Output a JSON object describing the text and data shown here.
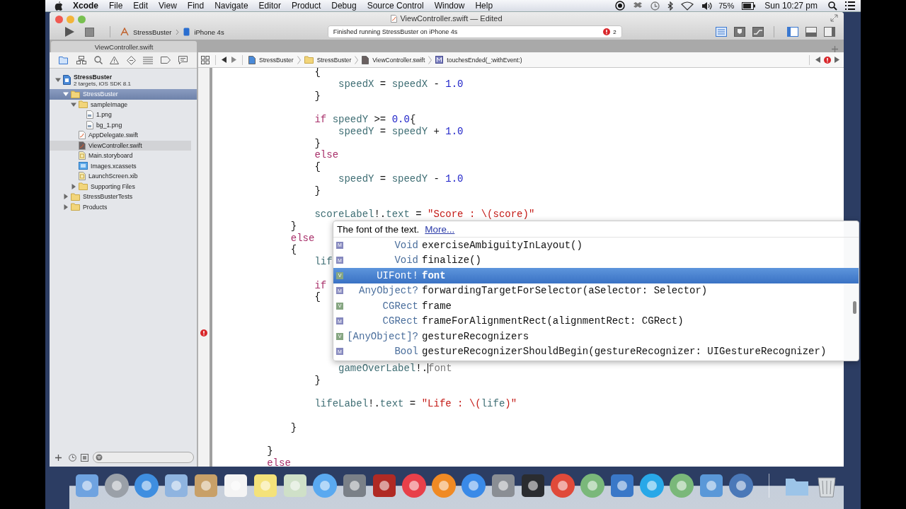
{
  "menu_bar": {
    "app": "Xcode",
    "menus": [
      "File",
      "Edit",
      "View",
      "Find",
      "Navigate",
      "Editor",
      "Product",
      "Debug",
      "Source Control",
      "Window",
      "Help"
    ],
    "battery": "75%",
    "clock": "Sun 10:27 pm"
  },
  "window": {
    "title": "ViewController.swift — Edited",
    "scheme": "StressBuster",
    "destination": "iPhone 4s",
    "status": "Finished running StressBuster on iPhone 4s",
    "error_count": "2"
  },
  "tabs": [
    {
      "label": "ViewController.swift",
      "selected": true
    }
  ],
  "navigator": {
    "tree": [
      {
        "name": "StressBuster",
        "subtitle": "2 targets, iOS SDK 8.1",
        "kind": "project",
        "expanded": true,
        "selected": false,
        "children": [
          {
            "name": "StressBuster",
            "kind": "folder",
            "expanded": true,
            "selected": true,
            "children": [
              {
                "name": "sampleImage",
                "kind": "folder",
                "expanded": true,
                "selected": false,
                "children": [
                  {
                    "name": "1.png",
                    "kind": "image",
                    "selected": false
                  },
                  {
                    "name": "bg_1.png",
                    "kind": "image",
                    "selected": false
                  }
                ]
              },
              {
                "name": "AppDelegate.swift",
                "kind": "swift",
                "selected": false
              },
              {
                "name": "ViewController.swift",
                "kind": "swift",
                "selected": false,
                "current": true
              },
              {
                "name": "Main.storyboard",
                "kind": "storyboard",
                "selected": false
              },
              {
                "name": "Images.xcassets",
                "kind": "assets",
                "selected": false
              },
              {
                "name": "LaunchScreen.xib",
                "kind": "xib",
                "selected": false
              },
              {
                "name": "Supporting Files",
                "kind": "folder",
                "expanded": false,
                "selected": false
              }
            ]
          },
          {
            "name": "StressBusterTests",
            "kind": "folder",
            "expanded": false,
            "selected": false
          },
          {
            "name": "Products",
            "kind": "folder",
            "expanded": false,
            "selected": false
          }
        ]
      }
    ]
  },
  "jump_bar": [
    {
      "label": "StressBuster",
      "kind": "project"
    },
    {
      "label": "StressBuster",
      "kind": "folder"
    },
    {
      "label": "ViewController.swift",
      "kind": "swift"
    },
    {
      "label": "touchesEnded(_:withEvent:)",
      "kind": "method"
    }
  ],
  "editor": {
    "lines": [
      {
        "kind": "code",
        "tokens": [
          {
            "text": "                {",
            "kind": "plain"
          }
        ]
      },
      {
        "kind": "code",
        "tokens": [
          {
            "text": "                    speedX",
            "kind": "identifier"
          },
          {
            "text": " = ",
            "kind": "plain"
          },
          {
            "text": "speedX",
            "kind": "identifier"
          },
          {
            "text": " - ",
            "kind": "plain"
          },
          {
            "text": "1.0",
            "kind": "number"
          }
        ]
      },
      {
        "kind": "code",
        "tokens": [
          {
            "text": "                }",
            "kind": "plain"
          }
        ]
      },
      {
        "kind": "blank"
      },
      {
        "kind": "code",
        "tokens": [
          {
            "text": "                if",
            "kind": "keyword"
          },
          {
            "text": " speedY",
            "kind": "identifier"
          },
          {
            "text": " >= ",
            "kind": "plain"
          },
          {
            "text": "0.0",
            "kind": "number"
          },
          {
            "text": "{",
            "kind": "plain"
          }
        ]
      },
      {
        "kind": "code",
        "tokens": [
          {
            "text": "                    speedY",
            "kind": "identifier"
          },
          {
            "text": " = ",
            "kind": "plain"
          },
          {
            "text": "speedY",
            "kind": "identifier"
          },
          {
            "text": " + ",
            "kind": "plain"
          },
          {
            "text": "1.0",
            "kind": "number"
          }
        ]
      },
      {
        "kind": "code",
        "tokens": [
          {
            "text": "                }",
            "kind": "plain"
          }
        ]
      },
      {
        "kind": "code",
        "tokens": [
          {
            "text": "                else",
            "kind": "keyword"
          }
        ]
      },
      {
        "kind": "code",
        "tokens": [
          {
            "text": "                {",
            "kind": "plain"
          }
        ]
      },
      {
        "kind": "code",
        "tokens": [
          {
            "text": "                    speedY",
            "kind": "identifier"
          },
          {
            "text": " = ",
            "kind": "plain"
          },
          {
            "text": "speedY",
            "kind": "identifier"
          },
          {
            "text": " - ",
            "kind": "plain"
          },
          {
            "text": "1.0",
            "kind": "number"
          }
        ]
      },
      {
        "kind": "code",
        "tokens": [
          {
            "text": "                }",
            "kind": "plain"
          }
        ]
      },
      {
        "kind": "blank"
      },
      {
        "kind": "code",
        "tokens": [
          {
            "text": "                scoreLabel",
            "kind": "identifier"
          },
          {
            "text": "!.",
            "kind": "plain"
          },
          {
            "text": "text",
            "kind": "identifier"
          },
          {
            "text": " = ",
            "kind": "plain"
          },
          {
            "text": "\"Score : \\(score)\"",
            "kind": "string"
          }
        ]
      },
      {
        "kind": "code",
        "tokens": [
          {
            "text": "            }",
            "kind": "plain"
          }
        ]
      },
      {
        "kind": "code",
        "tokens": [
          {
            "text": "            else",
            "kind": "keyword"
          }
        ]
      },
      {
        "kind": "code",
        "tokens": [
          {
            "text": "            {",
            "kind": "plain"
          }
        ]
      },
      {
        "kind": "code",
        "tokens": [
          {
            "text": "                lif",
            "kind": "identifier"
          }
        ]
      },
      {
        "kind": "blank"
      },
      {
        "kind": "code",
        "tokens": [
          {
            "text": "                if",
            "kind": "keyword"
          }
        ]
      },
      {
        "kind": "code",
        "tokens": [
          {
            "text": "                {",
            "kind": "plain"
          }
        ]
      },
      {
        "kind": "blank"
      },
      {
        "kind": "blank"
      },
      {
        "kind": "blank",
        "error": true
      },
      {
        "kind": "blank"
      },
      {
        "kind": "blank"
      },
      {
        "kind": "code",
        "tokens": [
          {
            "text": "                    gameOverLabel",
            "kind": "identifier"
          },
          {
            "text": "!.",
            "kind": "plain"
          },
          {
            "kind": "caret"
          },
          {
            "text": "font",
            "kind": "ghost"
          }
        ]
      },
      {
        "kind": "code",
        "tokens": [
          {
            "text": "                }",
            "kind": "plain"
          }
        ]
      },
      {
        "kind": "blank"
      },
      {
        "kind": "code",
        "tokens": [
          {
            "text": "                lifeLabel",
            "kind": "identifier"
          },
          {
            "text": "!.",
            "kind": "plain"
          },
          {
            "text": "text",
            "kind": "identifier"
          },
          {
            "text": " = ",
            "kind": "plain"
          },
          {
            "text": "\"Life : \\(",
            "kind": "string"
          },
          {
            "text": "life",
            "kind": "identifier"
          },
          {
            "text": ")\"",
            "kind": "string"
          }
        ]
      },
      {
        "kind": "blank"
      },
      {
        "kind": "code",
        "tokens": [
          {
            "text": "            }",
            "kind": "plain"
          }
        ]
      },
      {
        "kind": "blank"
      },
      {
        "kind": "code",
        "tokens": [
          {
            "text": "        }",
            "kind": "plain"
          }
        ]
      },
      {
        "kind": "code",
        "tokens": [
          {
            "text": "        else",
            "kind": "keyword"
          }
        ]
      }
    ]
  },
  "completion": {
    "doc": "The font of the text.",
    "link": "More...",
    "items": [
      {
        "badge": "M",
        "kind": "method",
        "type": "Void",
        "name": "exerciseAmbiguityInLayout()",
        "selected": false
      },
      {
        "badge": "M",
        "kind": "method",
        "type": "Void",
        "name": "finalize()",
        "selected": false
      },
      {
        "badge": "V",
        "kind": "property",
        "type": "UIFont!",
        "name": "font",
        "selected": true
      },
      {
        "badge": "M",
        "kind": "method",
        "type": "AnyObject?",
        "name": "forwardingTargetForSelector(aSelector: Selector)",
        "selected": false
      },
      {
        "badge": "V",
        "kind": "property",
        "type": "CGRect",
        "name": "frame",
        "selected": false
      },
      {
        "badge": "M",
        "kind": "method",
        "type": "CGRect",
        "name": "frameForAlignmentRect(alignmentRect: CGRect)",
        "selected": false
      },
      {
        "badge": "V",
        "kind": "property",
        "type": "[AnyObject]?",
        "name": "gestureRecognizers",
        "selected": false
      },
      {
        "badge": "M",
        "kind": "method",
        "type": "Bool",
        "name": "gestureRecognizerShouldBegin(gestureRecognizer: UIGestureRecognizer)",
        "selected": false
      }
    ]
  }
}
